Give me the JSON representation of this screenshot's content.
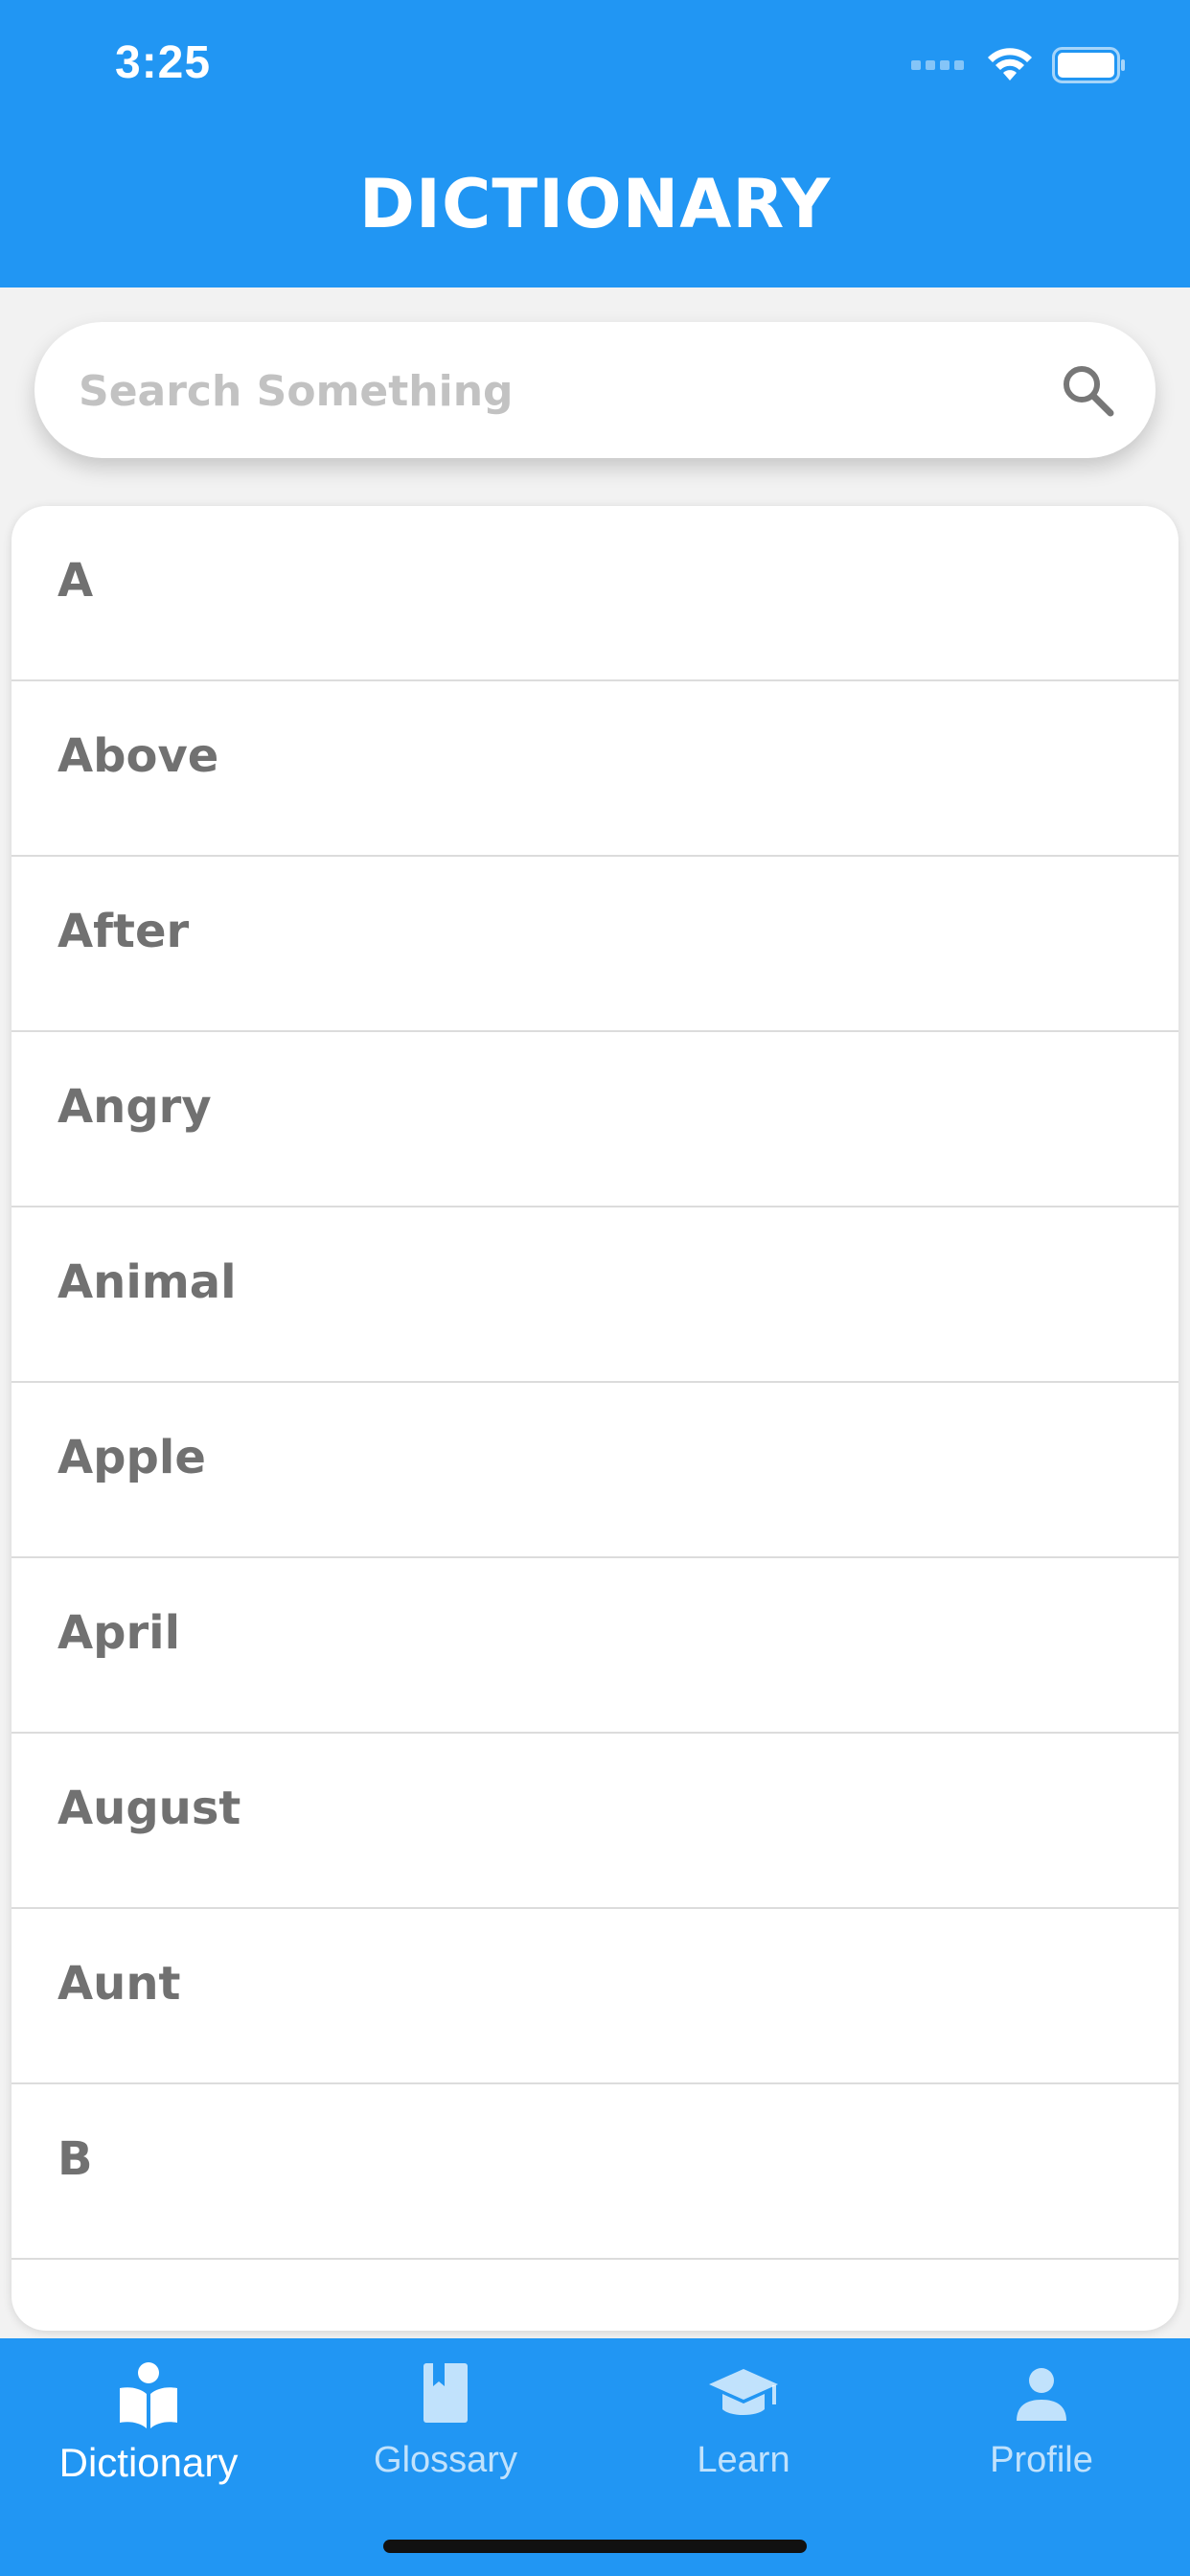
{
  "status_bar": {
    "time": "3:25"
  },
  "header": {
    "title": "DICTIONARY"
  },
  "search": {
    "placeholder": "Search Something",
    "value": ""
  },
  "list": {
    "items": [
      {
        "label": "A"
      },
      {
        "label": "Above"
      },
      {
        "label": "After"
      },
      {
        "label": "Angry"
      },
      {
        "label": "Animal"
      },
      {
        "label": "Apple"
      },
      {
        "label": "April"
      },
      {
        "label": "August"
      },
      {
        "label": "Aunt"
      },
      {
        "label": "B"
      }
    ]
  },
  "bottom_nav": {
    "items": [
      {
        "label": "Dictionary",
        "icon": "book-reader-icon",
        "active": true
      },
      {
        "label": "Glossary",
        "icon": "bookmark-book-icon",
        "active": false
      },
      {
        "label": "Learn",
        "icon": "graduation-cap-icon",
        "active": false
      },
      {
        "label": "Profile",
        "icon": "person-icon",
        "active": false
      }
    ]
  },
  "colors": {
    "primary": "#2196f3",
    "list_text": "#717171",
    "placeholder": "#c2c2c2",
    "background": "#f2f2f2"
  }
}
